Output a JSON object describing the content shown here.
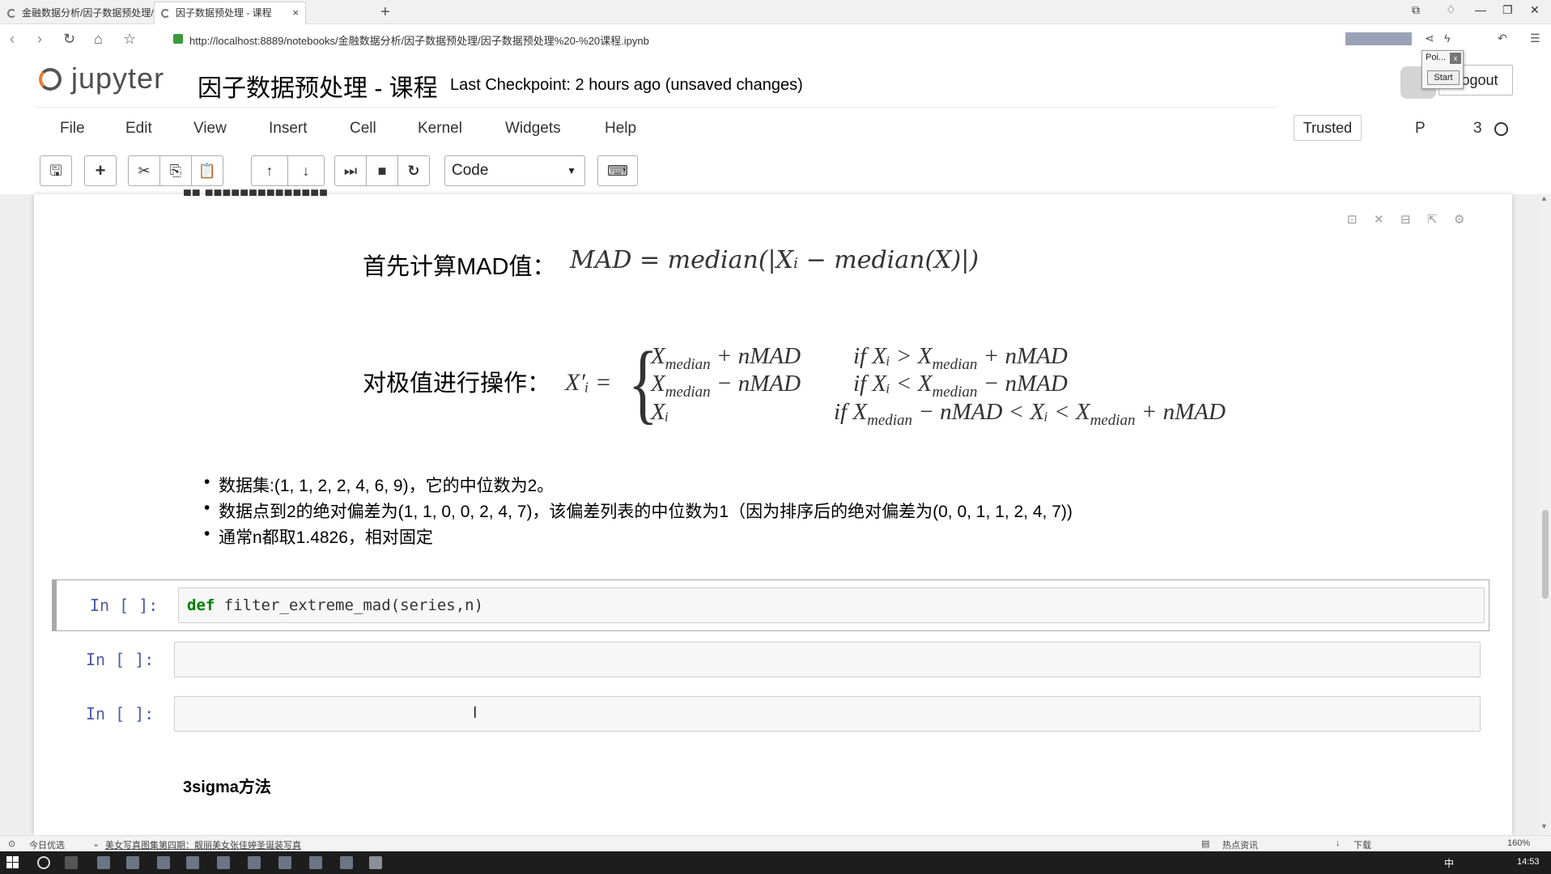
{
  "browser": {
    "tabs": [
      {
        "label": "金融数据分析/因子数据预处理/"
      },
      {
        "label": "因子数据预处理 - 课程"
      }
    ],
    "url": "http://localhost:8889/notebooks/金融数据分析/因子数据预处理/因子数据预处理%20-%20课程.ipynb",
    "tab_close": "×",
    "new_tab": "+"
  },
  "jupyter": {
    "logo_text": "jupyter",
    "title": "因子数据预处理 - 课程",
    "checkpoint": "Last Checkpoint: 2 hours ago (unsaved changes)",
    "logout": "Logout",
    "popup_title": "Poi...",
    "popup_button": "Start",
    "trusted": "Trusted",
    "kernel_indicator": "P",
    "kernel_suffix": "3"
  },
  "menu": [
    "File",
    "Edit",
    "View",
    "Insert",
    "Cell",
    "Kernel",
    "Widgets",
    "Help"
  ],
  "toolbar": {
    "cell_type": "Code"
  },
  "notebook": {
    "formula1_label": "首先计算MAD值：",
    "formula1": "MAD = median(|Xᵢ − median(X)|)",
    "formula2_label": "对极值进行操作：",
    "formula2_lhs": "X′ᵢ =",
    "cases": [
      {
        "value": "X",
        "value_sub": "median",
        "value_rest": " + nMAD",
        "cond": "if  Xᵢ > X",
        "cond_sub": "median",
        "cond_rest": " + nMAD"
      },
      {
        "value": "X",
        "value_sub": "median",
        "value_rest": " − nMAD",
        "cond": "if  Xᵢ < X",
        "cond_sub": "median",
        "cond_rest": " − nMAD"
      },
      {
        "value": "Xᵢ",
        "value_sub": "",
        "value_rest": "",
        "cond": "if  X",
        "cond_sub": "median",
        "cond_rest": " − nMAD < Xᵢ < X",
        "cond_sub2": "median",
        "cond_rest2": " + nMAD"
      }
    ],
    "bullets": [
      "数据集:(1, 1, 2, 2, 4, 6, 9)，它的中位数为2。",
      "数据点到2的绝对偏差为(1, 1, 0, 0, 2, 4, 7)，该偏差列表的中位数为1（因为排序后的绝对偏差为(0, 0, 1, 1, 2, 4, 7))",
      "通常n都取1.4826，相对固定"
    ],
    "cells": [
      {
        "prompt": "In  [  ]:",
        "keyword": "def",
        "code": " filter_extreme_mad(series,n)"
      },
      {
        "prompt": "In  [  ]:",
        "keyword": "",
        "code": ""
      },
      {
        "prompt": "In  [  ]:",
        "keyword": "",
        "code": ""
      }
    ],
    "next_heading": "3sigma方法"
  },
  "statusbar": {
    "left": "今日优选",
    "news": "美女写真图集第四期：靓丽美女张佳婷圣诞装写真",
    "hot": "热点资讯",
    "download": "下载",
    "zoom": "160%"
  },
  "taskbar": {
    "ime": "中",
    "clock": "14:53"
  }
}
